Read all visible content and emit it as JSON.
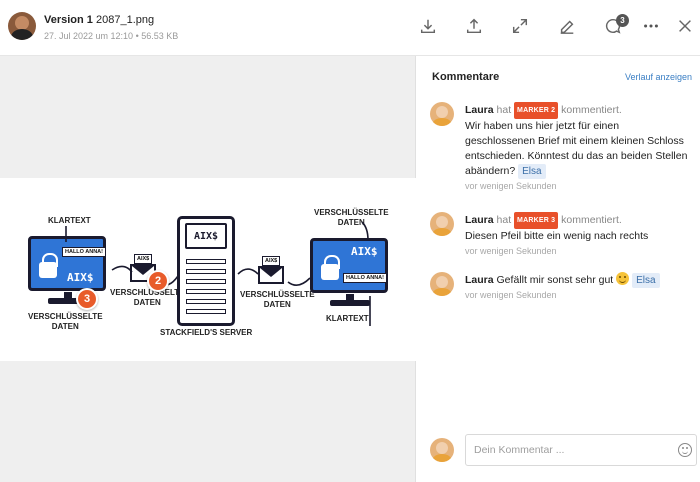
{
  "header": {
    "version_label": "Version 1",
    "file_name": "2087_1.png",
    "date": "27. Jul 2022 um 12:10",
    "separator": "•",
    "file_size": "56.53 KB",
    "comment_count": "3",
    "icons": [
      "download-icon",
      "upload-icon",
      "expand-icon",
      "edit-icon",
      "comment-icon",
      "more-icon",
      "close-icon"
    ]
  },
  "diagram": {
    "klartext_left": "KLARTEXT",
    "verschluesselt_left": "VERSCHLÜSSELTE\nDATEN",
    "hallo_left": "HALLO ANNA!",
    "aix_left": "AIX$",
    "envelope_note_left": "AIX$",
    "verschluesselt_mid_left": "VERSCHLÜSSELTE\nDATEN",
    "server_text": "AIX$",
    "server_label": "STACKFIELD'S SERVER",
    "envelope_note_right": "AIX$",
    "verschluesselt_mid_right": "VERSCHLÜSSELTE\nDATEN",
    "verschluesselt_top_right": "VERSCHLÜSSELTE\nDATEN",
    "aix_right": "AIX$",
    "hallo_right": "HALLO ANNA!",
    "klartext_right": "KLARTEXT",
    "marker_2": "2",
    "marker_3": "3"
  },
  "panel": {
    "title": "Kommentare",
    "history_link": "Verlauf anzeigen",
    "comments": [
      {
        "author": "Laura",
        "verb_pre": "hat",
        "marker": "MARKER 2",
        "verb_post": "kommentiert.",
        "text": "Wir haben uns hier jetzt für einen geschlossenen Brief mit einem kleinen Schloss entschieden. Könntest du das an beiden Stellen abändern?",
        "mention": "Elsa",
        "time": "vor wenigen Sekunden"
      },
      {
        "author": "Laura",
        "verb_pre": "hat",
        "marker": "MARKER 3",
        "verb_post": "kommentiert.",
        "text": "Diesen Pfeil bitte ein wenig nach rechts",
        "time": "vor wenigen Sekunden"
      },
      {
        "author": "Laura",
        "text": "Gefällt mir sonst sehr gut",
        "mention": "Elsa",
        "time": "vor wenigen Sekunden"
      }
    ],
    "input_placeholder": "Dein Kommentar ..."
  }
}
